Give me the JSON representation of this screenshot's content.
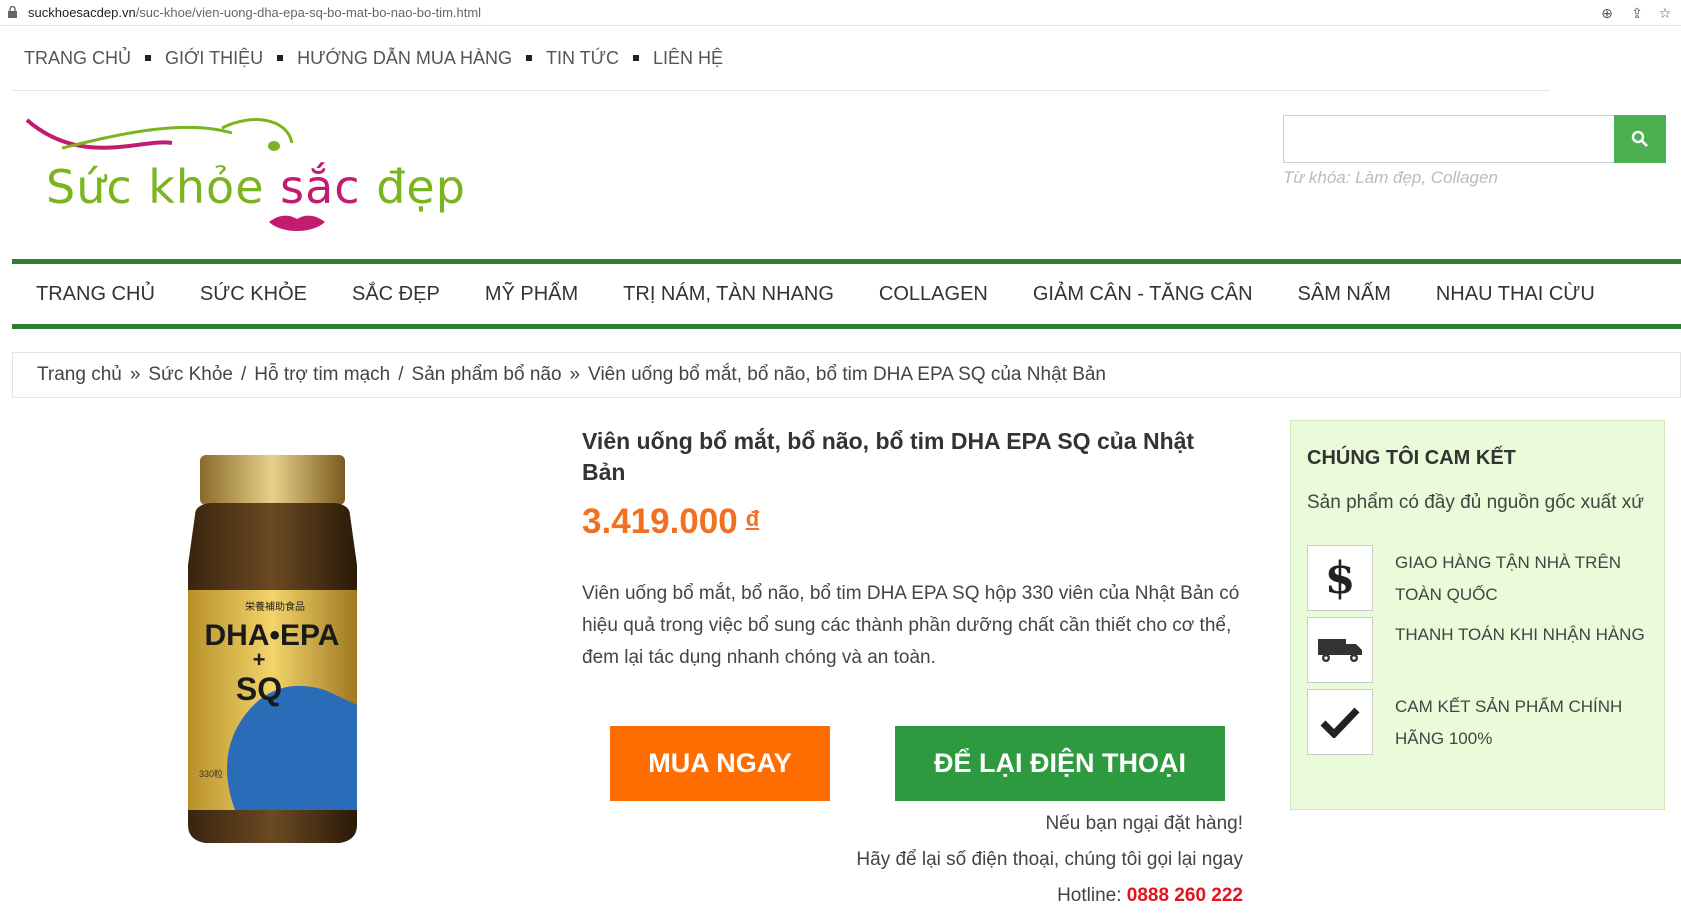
{
  "browser": {
    "url_domain": "suckhoesacdep.vn",
    "url_path": "/suc-khoe/vien-uong-dha-epa-sq-bo-mat-bo-nao-bo-tim.html"
  },
  "topnav": [
    "TRANG CHỦ",
    "GIỚI THIỆU",
    "HƯỚNG DẪN MUA HÀNG",
    "TIN TỨC",
    "LIÊN HỆ"
  ],
  "logo": {
    "part1": "Sức khỏe ",
    "part2": "sắc",
    "part3": " đẹp"
  },
  "search": {
    "placeholder": "",
    "hint": "Từ khóa: Làm đẹp, Collagen"
  },
  "mainnav": [
    "TRANG CHỦ",
    "SỨC KHỎE",
    "SẮC ĐẸP",
    "MỸ PHẨM",
    "TRỊ NÁM, TÀN NHANG",
    "COLLAGEN",
    "GIẢM CÂN - TĂNG CÂN",
    "SÂM NẤM",
    "NHAU THAI CỪU"
  ],
  "breadcrumb": {
    "home": "Trang chủ",
    "sep1": "»",
    "c1": "Sức Khỏe",
    "sep2": "/",
    "c2": "Hỗ trợ tim mạch",
    "sep3": "/",
    "c3": "Sản phẩm bổ não",
    "sep4": "»",
    "current": "Viên uống bổ mắt, bổ não, bổ tim DHA EPA SQ của Nhật Bản"
  },
  "product": {
    "title": "Viên uống bổ mắt, bổ não, bổ tim DHA EPA SQ của Nhật Bản",
    "price": "3.419.000",
    "currency": "đ",
    "description": "Viên uống bổ mắt, bổ não, bổ tim DHA EPA SQ hộp 330 viên của Nhật Bản có hiệu quả trong việc bổ sung các thành phần dưỡng chất cần thiết cho cơ thể, đem lại tác dụng nhanh chóng và an toàn.",
    "buy_label": "MUA NGAY",
    "leave_label": "ĐỂ LẠI ĐIỆN THOẠI",
    "note1": "Nếu bạn ngại đặt hàng!",
    "note2": "Hãy để lại số điện thoại, chúng tôi gọi lại ngay",
    "hotline_label": "Hotline: ",
    "hotline": "0888 260 222",
    "bottle": {
      "brand": "DHA•EPA",
      "plus": "+",
      "sq": "SQ",
      "count": "330粒",
      "jp": "栄養補助食品"
    }
  },
  "commit": {
    "title": "CHÚNG TÔI CAM KẾT",
    "subtitle": "Sản phẩm có đầy đủ nguồn gốc xuất xứ",
    "items": [
      {
        "icon": "dollar-icon",
        "label": "GIAO HÀNG TẬN NHÀ TRÊN TOÀN QUỐC"
      },
      {
        "icon": "truck-icon",
        "label": "THANH TOÁN KHI NHẬN HÀNG"
      },
      {
        "icon": "check-icon",
        "label": "CAM KẾT SẢN PHẨM CHÍNH HÃNG 100%"
      }
    ]
  },
  "colors": {
    "green": "#2e7d32",
    "orange": "#ff6c00",
    "price": "#f36f21",
    "hotline": "#e3141b",
    "commit_bg": "#e9fbd9"
  }
}
